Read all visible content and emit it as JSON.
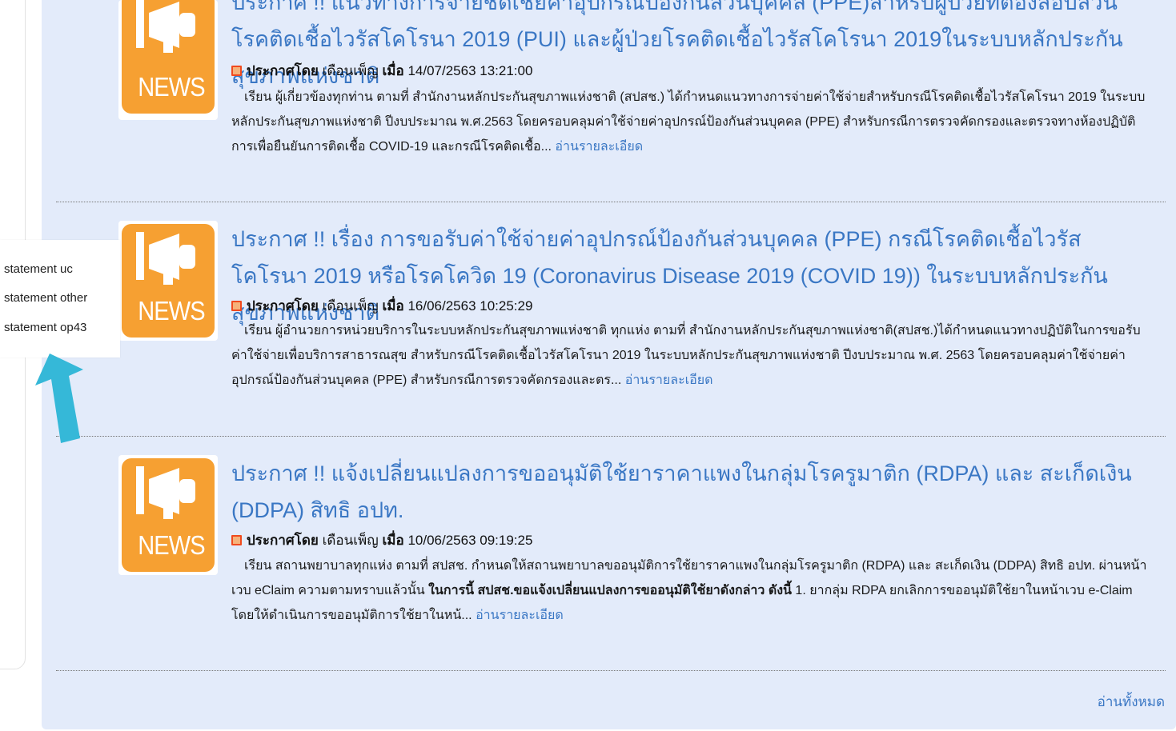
{
  "colors": {
    "accent": "#3a77c4",
    "news_tile": "#f6a032",
    "background": "#e3ebfa",
    "arrow": "#35b8d8"
  },
  "news": [
    {
      "title": "ประกาศ !! แนวทางการจ่ายชดเชยค่าอุปกรณ์ป้องกันส่วนบุคคล (PPE)สำหรับผู้ป่วยที่ต้องสอบสวนโรคติดเชื้อไวรัสโคโรนา 2019 (PUI) และผู้ป่วยโรคติดเชื้อไวรัสโคโรนา 2019ในระบบหลักประกันสุขภาพแห่งชาติ",
      "announced_label": "ประกาศโดย",
      "author": "เดือนเพ็ญ",
      "when_label": "เมื่อ",
      "date": "14/07/2563 13:21:00",
      "excerpt": "เรียน ผู้เกี่ยวข้องทุกท่าน ตามที่ สำนักงานหลักประกันสุขภาพแห่งชาติ (สปสช.) ได้กำหนดแนวทางการจ่ายค่าใช้จ่ายสำหรับกรณีโรคติดเชื้อไวรัสโคโรนา 2019 ในระบบหลักประกันสุขภาพแห่งชาติ ปีงบประมาณ พ.ศ.2563 โดยครอบคลุมค่าใช้จ่ายค่าอุปกรณ์ป้องกันส่วนบุคคล (PPE) สำหรับกรณีการตรวจคัดกรองและตรวจทางห้องปฏิบัติการเพื่อยืนยันการติดเชื้อ COVID-19 และกรณีโรคติดเชื้อ...",
      "read_more": "อ่านรายละเอียด"
    },
    {
      "title": "ประกาศ !! เรื่อง การขอรับค่าใช้จ่ายค่าอุปกรณ์ป้องกันส่วนบุคคล (PPE) กรณีโรคติดเชื้อไวรัสโคโรนา 2019 หรือโรคโควิด 19 (Coronavirus Disease 2019 (COVID 19)) ในระบบหลักประกันสุขภาพแห่งชาติ",
      "announced_label": "ประกาศโดย",
      "author": "เดือนเพ็ญ",
      "when_label": "เมื่อ",
      "date": "16/06/2563 10:25:29",
      "excerpt": "เรียน ผู้อำนวยการหน่วยบริการในระบบหลักประกันสุขภาพแห่งชาติ ทุกแห่ง ตามที่ สำนักงานหลักประกันสุขภาพแห่งชาติ(สปสช.)ได้กำหนดแนวทางปฏิบัติในการขอรับค่าใช้จ่ายเพื่อบริการสาธารณสุข สำหรับกรณีโรคติดเชื้อไวรัสโคโรนา 2019 ในระบบหลักประกันสุขภาพแห่งชาติ ปีงบประมาณ พ.ศ. 2563 โดยครอบคลุมค่าใช้จ่ายค่าอุปกรณ์ป้องกันส่วนบุคคล (PPE) สำหรับกรณีการตรวจคัดกรองและตร...",
      "read_more": "อ่านรายละเอียด"
    },
    {
      "title": "ประกาศ !! แจ้งเปลี่ยนแปลงการขออนุมัติใช้ยาราคาแพงในกลุ่มโรครูมาติก (RDPA) และ สะเก็ดเงิน (DDPA) สิทธิ อปท.",
      "announced_label": "ประกาศโดย",
      "author": "เดือนเพ็ญ",
      "when_label": "เมื่อ",
      "date": "10/06/2563 09:19:25",
      "excerpt_plain": "เรียน สถานพยาบาลทุกแห่ง ตามที่ สปสช. กำหนดให้สถานพยาบาลขออนุมัติการใช้ยาราคาแพงในกลุ่มโรครูมาติก (RDPA) และ สะเก็ดเงิน (DDPA) สิทธิ อปท. ผ่านหน้าเวบ eClaim ความตามทราบแล้วนั้น ",
      "excerpt_bold": "ในการนี้ สปสช.ขอแจ้งเปลี่ยนแปลงการขออนุมัติใช้ยาดังกล่าว ดังนี้",
      "excerpt_tail": " 1. ยากลุ่ม RDPA ยกเลิกการขออนุมัติใช้ยาในหน้าเวบ e-Claim โดยให้ดำเนินการขออนุมัติการใช้ยาในหน้...",
      "read_more": "อ่านรายละเอียด"
    }
  ],
  "thumb_label": "NEWS",
  "read_all": "อ่านทั้งหมด",
  "popup_menu": [
    "statement uc",
    "statement other",
    "statement op43"
  ]
}
